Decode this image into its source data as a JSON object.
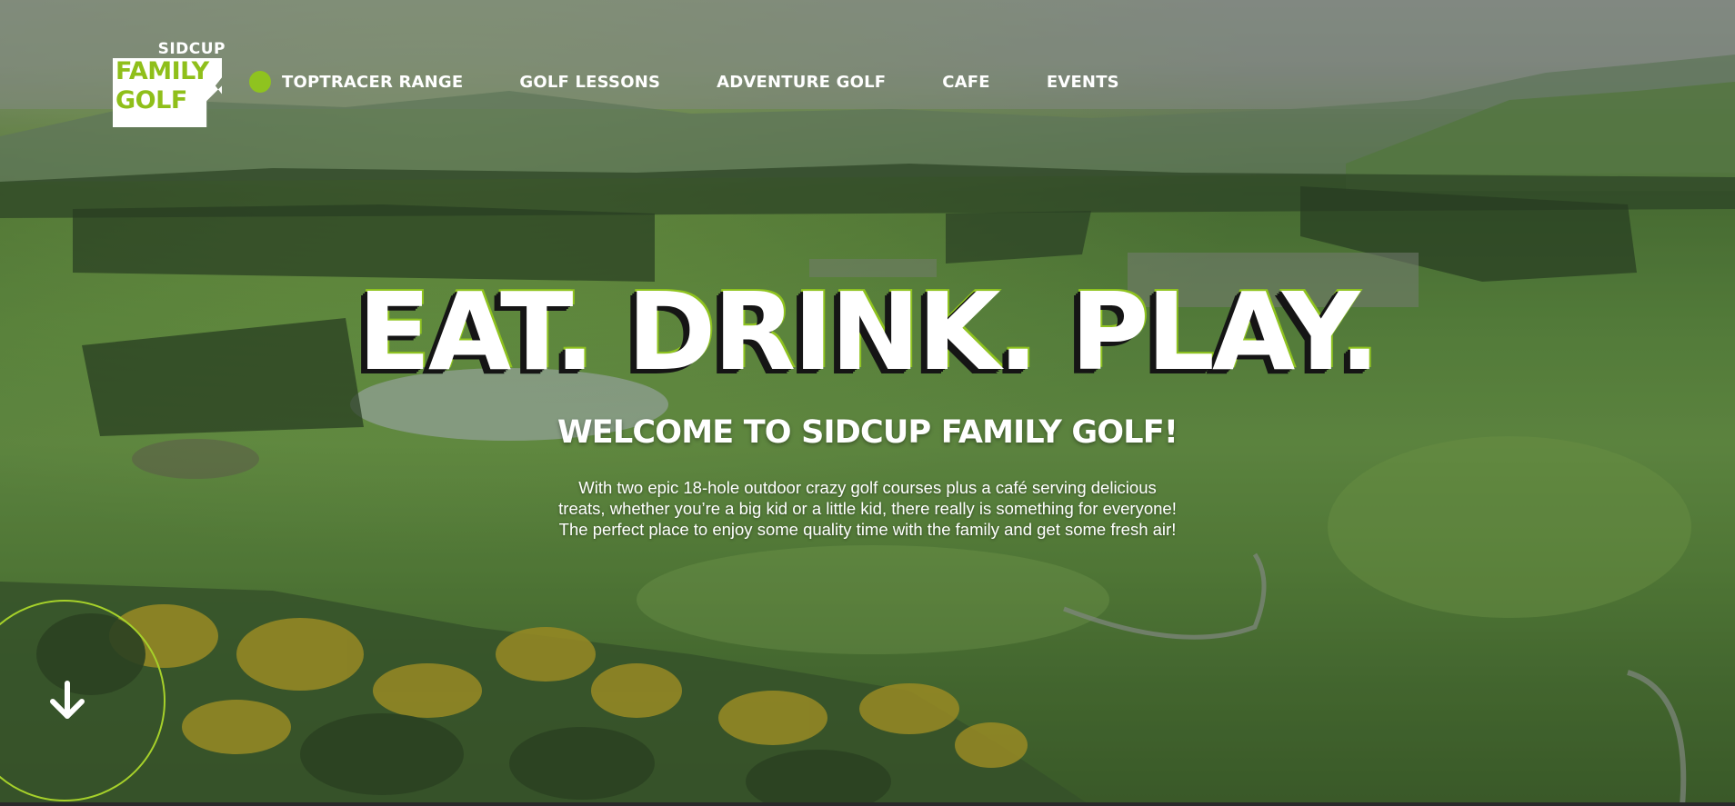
{
  "logo": {
    "top_text": "SIDCUP",
    "line1": "FAMILY",
    "line2": "GOLF"
  },
  "nav": {
    "items": [
      {
        "label": "TOPTRACER RANGE"
      },
      {
        "label": "GOLF LESSONS"
      },
      {
        "label": "ADVENTURE GOLF"
      },
      {
        "label": "CAFE"
      },
      {
        "label": "EVENTS"
      }
    ]
  },
  "hero": {
    "headline": "EAT. DRINK. PLAY.",
    "subheadline": "WELCOME TO SIDCUP FAMILY GOLF!",
    "intro_line1": "With two epic 18-hole outdoor crazy golf courses plus a café serving delicious",
    "intro_line2": "treats, whether you’re a big kid or a little kid, there really is something for everyone!",
    "intro_line3": "The perfect place to enjoy some quality time with the family and get some fresh air!"
  },
  "colors": {
    "accent_green": "#8fc31f",
    "text": "#ffffff",
    "headline_shadow": "#151515"
  },
  "icons": {
    "scroll": "arrow-down-icon",
    "nav_marker": "green-dot-icon"
  }
}
